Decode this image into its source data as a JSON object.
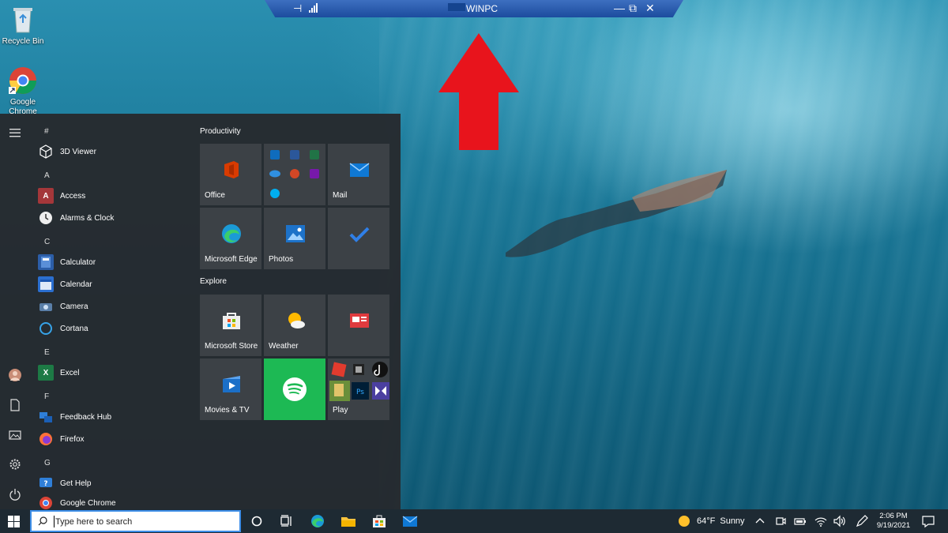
{
  "desktop": {
    "icons": [
      {
        "label": "Recycle Bin"
      },
      {
        "label": "Google Chrome"
      }
    ]
  },
  "remote_bar": {
    "title": "WINPC",
    "minimize": "—",
    "restore": "⧉",
    "close": "✕",
    "pin": "⊣"
  },
  "start_menu": {
    "menu_icon": "hamburger-icon",
    "sections": [
      {
        "letter": "#",
        "apps": [
          "3D Viewer"
        ]
      },
      {
        "letter": "A",
        "apps": [
          "Access",
          "Alarms & Clock"
        ]
      },
      {
        "letter": "C",
        "apps": [
          "Calculator",
          "Calendar",
          "Camera",
          "Cortana"
        ]
      },
      {
        "letter": "E",
        "apps": [
          "Excel"
        ]
      },
      {
        "letter": "F",
        "apps": [
          "Feedback Hub",
          "Firefox"
        ]
      },
      {
        "letter": "G",
        "apps": [
          "Get Help",
          "Google Chrome"
        ]
      }
    ],
    "groups": [
      {
        "title": "Productivity",
        "tiles": [
          "Office",
          "",
          "Mail",
          "Microsoft Edge",
          "Photos",
          ""
        ]
      },
      {
        "title": "Explore",
        "tiles": [
          "Microsoft Store",
          "Weather",
          "",
          "Movies & TV",
          "",
          "Play"
        ]
      }
    ]
  },
  "taskbar": {
    "search_placeholder": "Type here to search",
    "weather_temp": "64°F",
    "weather_cond": "Sunny",
    "time": "2:06 PM",
    "date": "9/19/2021"
  },
  "colors": {
    "accent": "#3d8ee8",
    "arrow": "#e8141c",
    "spotify": "#1db954",
    "tile": "#3c4146"
  }
}
